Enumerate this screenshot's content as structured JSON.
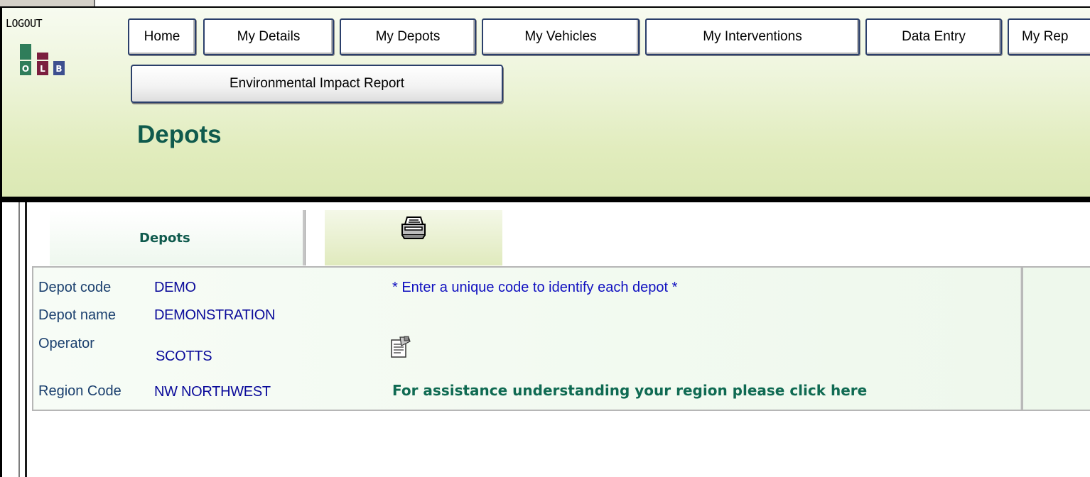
{
  "header": {
    "logout_label": "LOGOUT",
    "logo_letters": [
      "O",
      "L",
      "B"
    ],
    "nav": [
      "Home",
      "My Details",
      "My Depots",
      "My Vehicles",
      "My Interventions",
      "Data Entry",
      "My Rep"
    ],
    "sub_nav": "Environmental Impact Report",
    "page_title": "Depots"
  },
  "tabs": {
    "active_label": "Depots",
    "print_icon": "printer-icon"
  },
  "form": {
    "depot_code_label": "Depot code",
    "depot_code_value": "DEMO",
    "depot_code_hint": "* Enter a unique code to identify each depot *",
    "depot_name_label": "Depot name",
    "depot_name_value": "DEMONSTRATION",
    "operator_label": "Operator",
    "operator_value": "SCOTTS",
    "operator_icon": "operator-details-icon",
    "region_label": "Region Code",
    "region_value": "NW NORTHWEST",
    "region_help": "For assistance understanding your region please click here"
  },
  "colors": {
    "title_green": "#0f5a4d",
    "label_blue": "#1a3f6e",
    "value_blue": "#0a0a9a",
    "header_bg": "#e1ecbd"
  }
}
